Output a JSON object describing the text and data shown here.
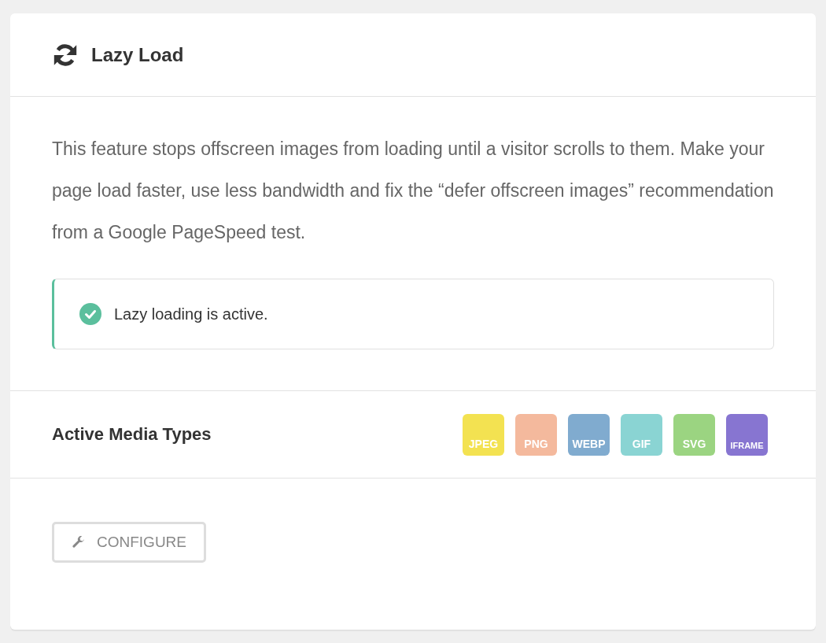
{
  "box": {
    "title": "Lazy Load"
  },
  "description": "This feature stops offscreen images from loading until a visitor scrolls to them. Make your page load faster, use less bandwidth and fix the “defer offscreen images” recommendation from a Google PageSpeed test.",
  "notice": {
    "kind": "success",
    "text": "Lazy loading is active."
  },
  "media_types": {
    "label": "Active Media Types",
    "items": [
      {
        "label": "JPEG",
        "color": "#f3e251"
      },
      {
        "label": "PNG",
        "color": "#f4b99d"
      },
      {
        "label": "WEBP",
        "color": "#80abcf"
      },
      {
        "label": "GIF",
        "color": "#8ad4d3"
      },
      {
        "label": "SVG",
        "color": "#9bd481"
      },
      {
        "label": "IFRAME",
        "color": "#8775d1"
      }
    ]
  },
  "footer": {
    "button": "CONFIGURE"
  }
}
